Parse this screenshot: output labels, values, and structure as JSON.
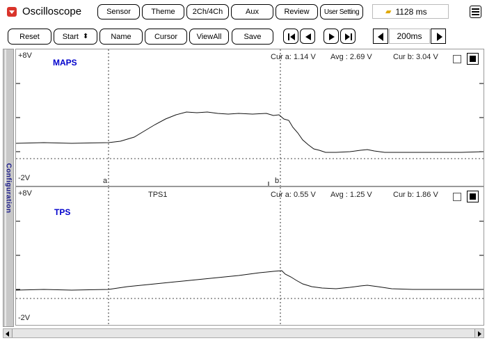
{
  "app": {
    "title": "Oscilloscope"
  },
  "toolbar_top": {
    "sensor": "Sensor",
    "theme": "Theme",
    "channels": "2Ch/4Ch",
    "aux": "Aux",
    "review": "Review",
    "user_setting": "User Setting",
    "time_readout": "1128 ms"
  },
  "toolbar_controls": {
    "reset": "Reset",
    "start": "Start",
    "start_spinner": "⬍",
    "name": "Name",
    "cursor": "Cursor",
    "view_all": "ViewAll",
    "save": "Save",
    "timebase": "200ms"
  },
  "side_tab": {
    "label": "Configuration"
  },
  "channels": [
    {
      "name": "MAPS",
      "sensor_label": "",
      "top_scale": "+8V",
      "bottom_scale": "-2V",
      "cur_a": "Cur a: 1.14 V",
      "avg": "Avg : 2.69 V",
      "cur_b": "Cur b: 3.04 V",
      "marker_a": "a",
      "marker_b": "b",
      "color": "#0000cc"
    },
    {
      "name": "TPS",
      "sensor_label": "TPS1",
      "top_scale": "+8V",
      "bottom_scale": "-2V",
      "cur_a": "Cur a: 0.55 V",
      "avg": "Avg : 1.25 V",
      "cur_b": "Cur b: 1.86 V",
      "color": "#0000cc"
    }
  ],
  "colors": {
    "accent_red": "#d9342b",
    "channel_label": "#0000cc",
    "panel_grey": "#c8c8c8"
  }
}
